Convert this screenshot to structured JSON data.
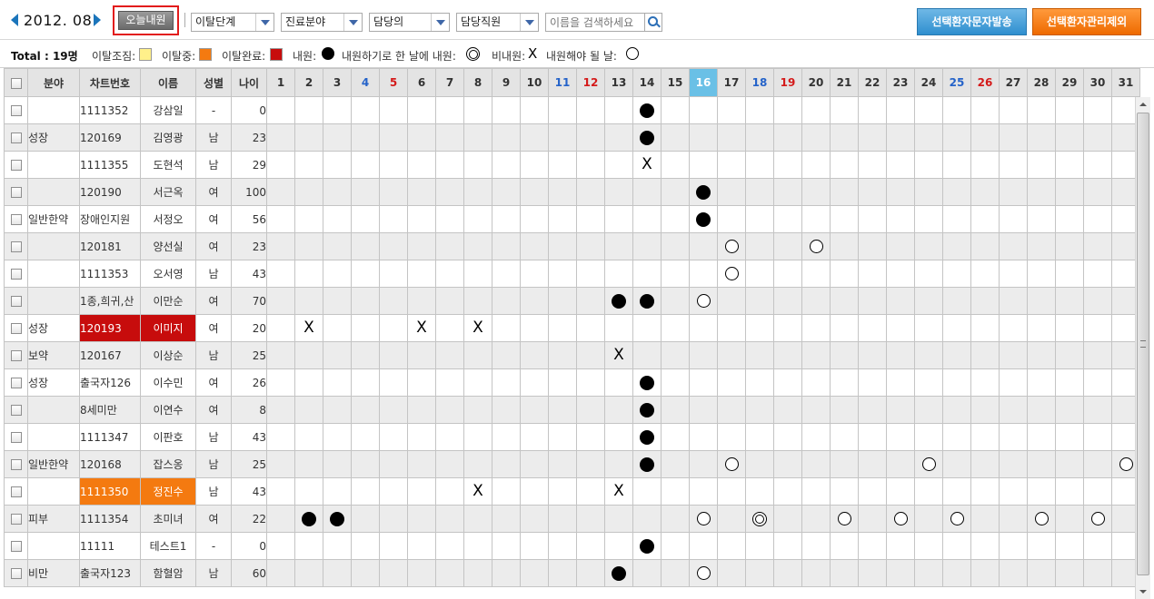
{
  "toolbar": {
    "month": "2012. 08",
    "today_button": "오늘내원",
    "filters": [
      "이탈단계",
      "진료분야",
      "담당의",
      "담당직원"
    ],
    "search_placeholder": "이름을 검색하세요",
    "send_sms_button": "선택환자문자발송",
    "exclude_button": "선택환자관리제외"
  },
  "legend": {
    "total": "Total : 19명",
    "warning": "이탈조짐:",
    "progress": "이탈중:",
    "complete": "이탈완료:",
    "visited": "내원:",
    "multi": "내원하기로 한 날에 내원:",
    "missed": "비내원:",
    "scheduled": "내원해야 될 날:",
    "colors": {
      "warning": "#fff08a",
      "progress": "#f47a10",
      "complete": "#c70c0c"
    }
  },
  "grid": {
    "headers": [
      "분야",
      "차트번호",
      "이름",
      "성별",
      "나이"
    ],
    "days": [
      "1",
      "2",
      "3",
      "4",
      "5",
      "6",
      "7",
      "8",
      "9",
      "10",
      "11",
      "12",
      "13",
      "14",
      "15",
      "16",
      "17",
      "18",
      "19",
      "20",
      "21",
      "22",
      "23",
      "24",
      "25",
      "26",
      "27",
      "28",
      "29",
      "30",
      "31"
    ],
    "day_types": {
      "sat": [
        "4",
        "11",
        "18",
        "25"
      ],
      "sun": [
        "5",
        "12",
        "19",
        "26"
      ],
      "today": "16"
    },
    "rows": [
      {
        "field": "",
        "chart": "1111352",
        "name": "강삼일",
        "gender": "-",
        "age": "0",
        "status": "",
        "marks": {
          "14": "visited"
        }
      },
      {
        "field": "성장",
        "chart": "120169",
        "name": "김영광",
        "gender": "남",
        "age": "23",
        "status": "",
        "marks": {
          "14": "visited"
        }
      },
      {
        "field": "",
        "chart": "1111355",
        "name": "도현석",
        "gender": "남",
        "age": "29",
        "status": "",
        "marks": {
          "14": "missed"
        }
      },
      {
        "field": "",
        "chart": "120190",
        "name": "서근옥",
        "gender": "여",
        "age": "100",
        "status": "",
        "marks": {
          "16": "visited"
        }
      },
      {
        "field": "일반한약",
        "chart": "장애인지원",
        "name": "서정오",
        "gender": "여",
        "age": "56",
        "status": "",
        "marks": {
          "16": "visited"
        }
      },
      {
        "field": "",
        "chart": "120181",
        "name": "양선실",
        "gender": "여",
        "age": "23",
        "status": "",
        "marks": {
          "17": "scheduled",
          "20": "scheduled"
        }
      },
      {
        "field": "",
        "chart": "1111353",
        "name": "오서영",
        "gender": "남",
        "age": "43",
        "status": "",
        "marks": {
          "17": "scheduled"
        }
      },
      {
        "field": "",
        "chart": "1종,희귀,산",
        "name": "이만순",
        "gender": "여",
        "age": "70",
        "status": "",
        "marks": {
          "13": "visited",
          "14": "visited",
          "16": "scheduled"
        }
      },
      {
        "field": "성장",
        "chart": "120193",
        "name": "이미지",
        "gender": "여",
        "age": "20",
        "status": "complete",
        "marks": {
          "2": "missed",
          "6": "missed",
          "8": "missed"
        }
      },
      {
        "field": "보약",
        "chart": "120167",
        "name": "이상순",
        "gender": "남",
        "age": "25",
        "status": "",
        "marks": {
          "13": "missed"
        }
      },
      {
        "field": "성장",
        "chart": "출국자126",
        "name": "이수민",
        "gender": "여",
        "age": "26",
        "status": "",
        "marks": {
          "14": "visited"
        }
      },
      {
        "field": "",
        "chart": "8세미만",
        "name": "이연수",
        "gender": "여",
        "age": "8",
        "status": "",
        "marks": {
          "14": "visited"
        }
      },
      {
        "field": "",
        "chart": "1111347",
        "name": "이판호",
        "gender": "남",
        "age": "43",
        "status": "",
        "marks": {
          "14": "visited"
        }
      },
      {
        "field": "일반한약",
        "chart": "120168",
        "name": "잡스옹",
        "gender": "남",
        "age": "25",
        "status": "",
        "marks": {
          "14": "visited",
          "17": "scheduled",
          "24": "scheduled",
          "31": "scheduled"
        }
      },
      {
        "field": "",
        "chart": "1111350",
        "name": "정진수",
        "gender": "남",
        "age": "43",
        "status": "progress",
        "marks": {
          "8": "missed",
          "13": "missed"
        }
      },
      {
        "field": "피부",
        "chart": "1111354",
        "name": "초미녀",
        "gender": "여",
        "age": "22",
        "status": "",
        "marks": {
          "2": "visited",
          "3": "visited",
          "16": "scheduled",
          "18": "multi",
          "21": "scheduled",
          "23": "scheduled",
          "25": "scheduled",
          "28": "scheduled",
          "30": "scheduled"
        }
      },
      {
        "field": "",
        "chart": "11111",
        "name": "테스트1",
        "gender": "-",
        "age": "0",
        "status": "",
        "marks": {
          "14": "visited"
        }
      },
      {
        "field": "비만",
        "chart": "출국자123",
        "name": "함혈암",
        "gender": "남",
        "age": "60",
        "status": "",
        "marks": {
          "13": "visited",
          "16": "scheduled"
        }
      }
    ]
  }
}
